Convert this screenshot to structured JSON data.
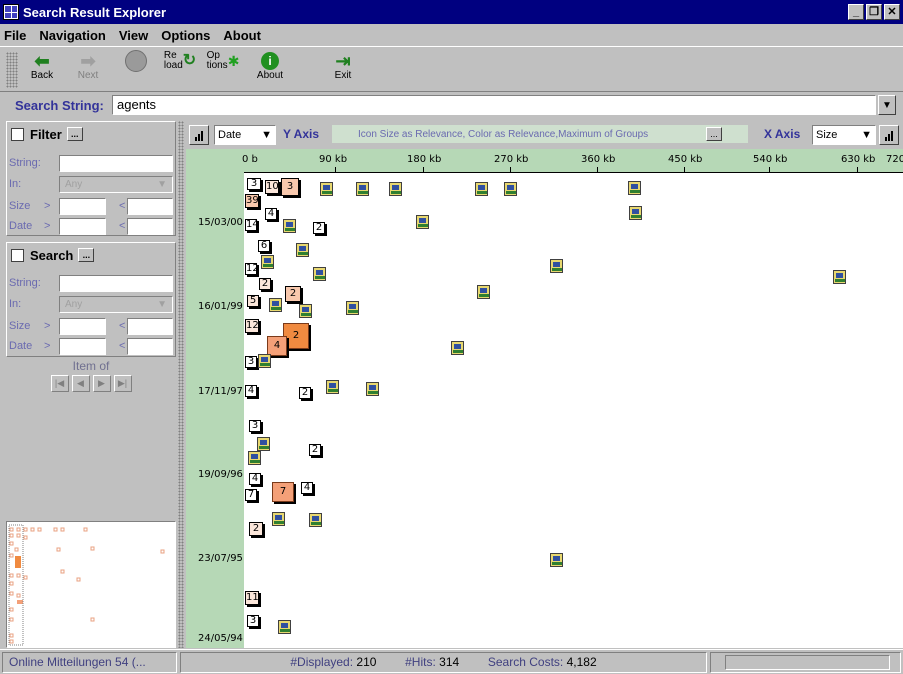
{
  "window": {
    "title": "Search Result Explorer"
  },
  "menu": [
    "File",
    "Navigation",
    "View",
    "Options",
    "About"
  ],
  "toolbar": {
    "back": "Back",
    "next": "Next",
    "reload_1": "Re",
    "reload_2": "load",
    "options_1": "Op",
    "options_2": "tions",
    "about": "About",
    "exit": "Exit"
  },
  "search": {
    "label": "Search String:",
    "value": "agents"
  },
  "filter": {
    "title": "Filter",
    "more": "...",
    "string_label": "String:",
    "in_label": "In:",
    "in_value": "Any",
    "size_label": "Size",
    "date_label": "Date",
    "gt": ">",
    "lt": "<"
  },
  "search_panel": {
    "title": "Search",
    "more": "...",
    "string_label": "String:",
    "in_label": "In:",
    "in_value": "Any",
    "size_label": "Size",
    "date_label": "Date",
    "gt": ">",
    "lt": "<",
    "item_of": "Item   of",
    "nav": [
      "|◀",
      "◀",
      "▶",
      "▶|"
    ]
  },
  "chart_header": {
    "y_select": "Date",
    "y_axis_label": "Y Axis",
    "description": "Icon Size as Relevance, Color as Relevance,Maximum of Groups",
    "more": "...",
    "x_axis_label": "X Axis",
    "x_select": "Size"
  },
  "chart_data": {
    "type": "scatter",
    "xlabel": "X Axis",
    "ylabel": "Y Axis",
    "x_ticks": [
      "0 b",
      "90 kb",
      "180 kb",
      "270 kb",
      "360 kb",
      "450 kb",
      "540 kb",
      "630 kb",
      "720"
    ],
    "y_ticks": [
      "15/03/00",
      "16/01/99",
      "17/11/97",
      "19/09/96",
      "23/07/95",
      "24/05/94"
    ],
    "groups": [
      {
        "label": "3"
      },
      {
        "label": "10"
      },
      {
        "label": "3"
      },
      {
        "label": "39"
      },
      {
        "label": "4"
      },
      {
        "label": "14"
      },
      {
        "label": "2"
      },
      {
        "label": "6"
      },
      {
        "label": "12"
      },
      {
        "label": "2"
      },
      {
        "label": "2"
      },
      {
        "label": "5"
      },
      {
        "label": "12"
      },
      {
        "label": "2"
      },
      {
        "label": "4"
      },
      {
        "label": "3"
      },
      {
        "label": "4"
      },
      {
        "label": "2"
      },
      {
        "label": "3"
      },
      {
        "label": "2"
      },
      {
        "label": "4"
      },
      {
        "label": "7"
      },
      {
        "label": "7"
      },
      {
        "label": "4"
      },
      {
        "label": "2"
      },
      {
        "label": "11"
      },
      {
        "label": "3"
      }
    ]
  },
  "status": {
    "source": "Online Mitteilungen 54 (...",
    "displayed_label": "#Displayed:",
    "displayed": "210",
    "hits_label": "#Hits:",
    "hits": "314",
    "costs_label": "Search Costs:",
    "costs": "4,182"
  }
}
